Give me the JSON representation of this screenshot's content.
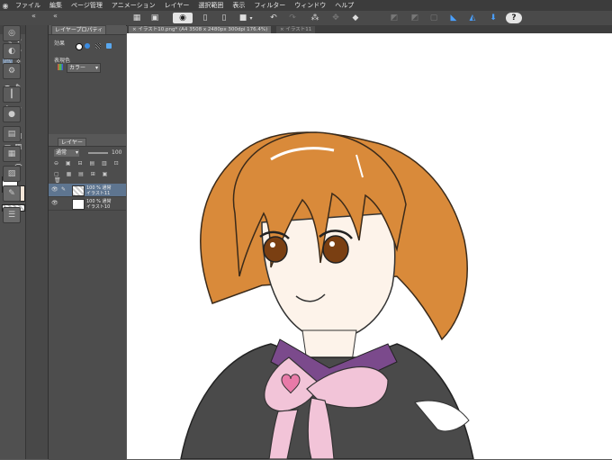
{
  "menu": {
    "items": [
      "ファイル",
      "編集",
      "ページ管理",
      "アニメーション",
      "レイヤー",
      "選択範囲",
      "表示",
      "フィルター",
      "ウィンドウ",
      "ヘルプ"
    ]
  },
  "panels": {
    "layer_property": {
      "tab_label": "レイヤープロパティ",
      "effect_label": "効果",
      "display_color_label": "表現色",
      "display_color_value": "カラー"
    },
    "layer": {
      "tab_label": "レイヤー",
      "blend_mode": "通常",
      "opacity": "100",
      "layers": [
        {
          "line1": "100 % 通常",
          "line2": "イラスト11",
          "active": true
        },
        {
          "line1": "100 % 通常",
          "line2": "イラスト10",
          "active": false
        }
      ]
    }
  },
  "documents": {
    "tabs": [
      {
        "label": "イラスト10.png* (A4 3508 x 2480px 300dpi 176.4%)",
        "active": true
      },
      {
        "label": "イラスト11",
        "active": false
      }
    ]
  },
  "colors": {
    "main": "#ffffff",
    "sub": "#f5e6d8",
    "hair": "#d98a3a",
    "skin": "#fdf3ea",
    "outfit": "#4a4a4a",
    "ribbon": "#f2c4d8",
    "collar": "#7b4a8c"
  }
}
